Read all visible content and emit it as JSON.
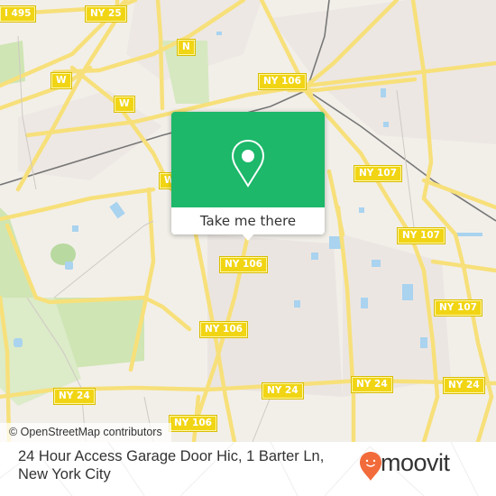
{
  "map": {
    "attribution": "© OpenStreetMap contributors",
    "road_labels": [
      {
        "id": "i495",
        "text": "I 495"
      },
      {
        "id": "ny25",
        "text": "NY 25"
      },
      {
        "id": "n",
        "text": "N"
      },
      {
        "id": "w1",
        "text": "W"
      },
      {
        "id": "w2",
        "text": "W"
      },
      {
        "id": "w3",
        "text": "W"
      },
      {
        "id": "ny106a",
        "text": "NY 106"
      },
      {
        "id": "ny107a",
        "text": "NY 107"
      },
      {
        "id": "ny107b",
        "text": "NY 107"
      },
      {
        "id": "ny107c",
        "text": "NY 107"
      },
      {
        "id": "ny106b",
        "text": "NY 106"
      },
      {
        "id": "ny106c",
        "text": "NY 106"
      },
      {
        "id": "ny24a",
        "text": "NY 24"
      },
      {
        "id": "ny24b",
        "text": "NY 24"
      },
      {
        "id": "ny24c",
        "text": "NY 24"
      },
      {
        "id": "ny24d",
        "text": "NY 24"
      },
      {
        "id": "ny106d",
        "text": "NY 106"
      }
    ]
  },
  "popup": {
    "icon": "map-pin-icon",
    "action_label": "Take me there"
  },
  "footer": {
    "address": "24 Hour Access Garage Door Hic, 1 Barter Ln, New York City",
    "brand": "moovit",
    "brand_color": "#f26b3a",
    "accent_color": "#1db86a"
  }
}
